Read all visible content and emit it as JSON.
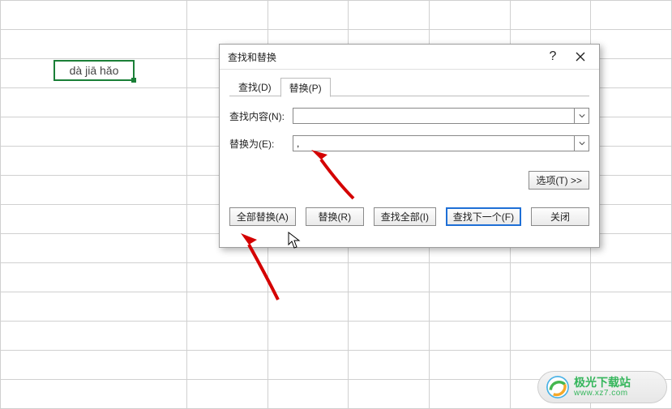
{
  "cell_value": "dà jiā hǎo",
  "dialog": {
    "title": "查找和替换",
    "help_tip": "?",
    "tabs": {
      "find": "查找(D)",
      "replace": "替换(P)"
    },
    "labels": {
      "find_what": "查找内容(N):",
      "replace_with": "替换为(E):"
    },
    "inputs": {
      "find_value": "",
      "replace_value": ","
    },
    "options_btn": "选项(T) >>",
    "buttons": {
      "replace_all": "全部替换(A)",
      "replace": "替换(R)",
      "find_all": "查找全部(I)",
      "find_next": "查找下一个(F)",
      "close": "关闭"
    }
  },
  "watermark": {
    "name": "极光下载站",
    "url": "www.xz7.com"
  }
}
